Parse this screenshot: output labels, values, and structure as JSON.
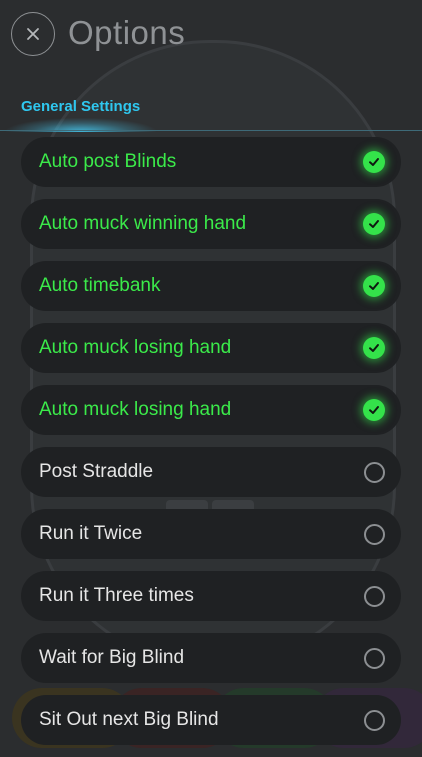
{
  "header": {
    "title": "Options"
  },
  "tabs": [
    {
      "label": "General Settings",
      "active": true
    }
  ],
  "options": [
    {
      "label": "Auto post Blinds",
      "checked": true
    },
    {
      "label": "Auto muck winning hand",
      "checked": true
    },
    {
      "label": "Auto timebank",
      "checked": true
    },
    {
      "label": "Auto muck losing hand",
      "checked": true
    },
    {
      "label": "Auto muck losing hand",
      "checked": true
    },
    {
      "label": "Post Straddle",
      "checked": false
    },
    {
      "label": "Run it Twice",
      "checked": false
    },
    {
      "label": "Run it Three times",
      "checked": false
    },
    {
      "label": "Wait for Big Blind",
      "checked": false
    },
    {
      "label": "Sit Out next Big Blind",
      "checked": false
    }
  ],
  "colors": {
    "accent": "#2fc7ef",
    "enabled": "#3bea4a",
    "background": "#2b2d2f",
    "row": "#1f2123"
  }
}
